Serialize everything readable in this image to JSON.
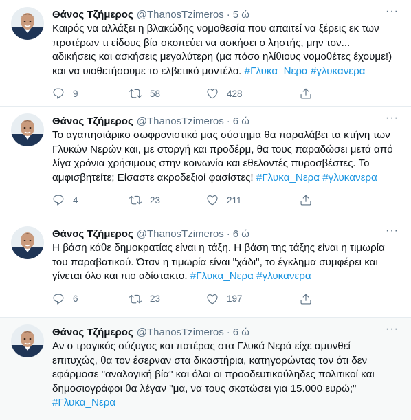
{
  "tweets": [
    {
      "name": "Θάνος Τζήμερος",
      "handle": "@ThanosTzimeros",
      "dot": "·",
      "time": "5 ώ",
      "text": "Καιρός να αλλάξει η βλακώδης νομοθεσία που απαιτεί να ξέρεις εκ των προτέρων τι είδους βία σκοπεύει να ασκήσει ο ληστής, μην τον... αδικήσεις και ασκήσεις μεγαλύτερη (μα πόσο ηλίθιους νομοθέτες έχουμε!) και να υιοθετήσουμε το ελβετικό μοντέλο. ",
      "hashtags": "#Γλυκα_Νερα #γλυκανερα",
      "replies": "9",
      "retweets": "58",
      "likes": "428"
    },
    {
      "name": "Θάνος Τζήμερος",
      "handle": "@ThanosTzimeros",
      "dot": "·",
      "time": "6 ώ",
      "text": "Το αγαπησιάρικο σωφρονιστικό μας σύστημα θα παραλάβει τα κτήνη των Γλυκών Νερών και, με στοργή και προδέρμ, θα τους παραδώσει μετά από λίγα χρόνια χρήσιμους στην κοινωνία και εθελοντές πυροσβέστες. Το αμφισβητείτε; Είσαστε ακροδεξιοί φασίστες! ",
      "hashtags": "#Γλυκα_Νερα #γλυκανερα",
      "replies": "4",
      "retweets": "23",
      "likes": "211"
    },
    {
      "name": "Θάνος Τζήμερος",
      "handle": "@ThanosTzimeros",
      "dot": "·",
      "time": "6 ώ",
      "text": "Η βάση κάθε δημοκρατίας είναι η τάξη. Η βάση της τάξης είναι η τιμωρία του παραβατικού. Όταν η τιμωρία είναι \"χάδι\", το έγκλημα συμφέρει και γίνεται όλο και πιο αδίστακτο. ",
      "hashtags": "#Γλυκα_Νερα #γλυκανερα",
      "replies": "6",
      "retweets": "23",
      "likes": "197"
    },
    {
      "name": "Θάνος Τζήμερος",
      "handle": "@ThanosTzimeros",
      "dot": "·",
      "time": "6 ώ",
      "text": "Αν ο τραγικός σύζυγος και πατέρας στα Γλυκά Νερά είχε αμυνθεί επιτυχώς, θα τον έσερναν στα δικαστήρια, κατηγορώντας τον ότι δεν εφάρμοσε \"αναλογική βία\" και όλοι οι προοδευτικούληδες πολιτικοί και δημοσιογράφοι θα λέγαν \"μα, να τους σκοτώσει για 15.000 ευρώ;\"\n",
      "hashtags": "#Γλυκα_Νερα",
      "replies": "",
      "retweets": "",
      "likes": ""
    }
  ],
  "colors": {
    "link": "#1b95e0",
    "muted": "#5b7083",
    "divider": "#e6ecf0",
    "highlight_bg": "#f7f9f9"
  },
  "icons": {
    "more": "more-icon",
    "reply": "reply-icon",
    "retweet": "retweet-icon",
    "like": "like-icon",
    "share": "share-icon"
  }
}
